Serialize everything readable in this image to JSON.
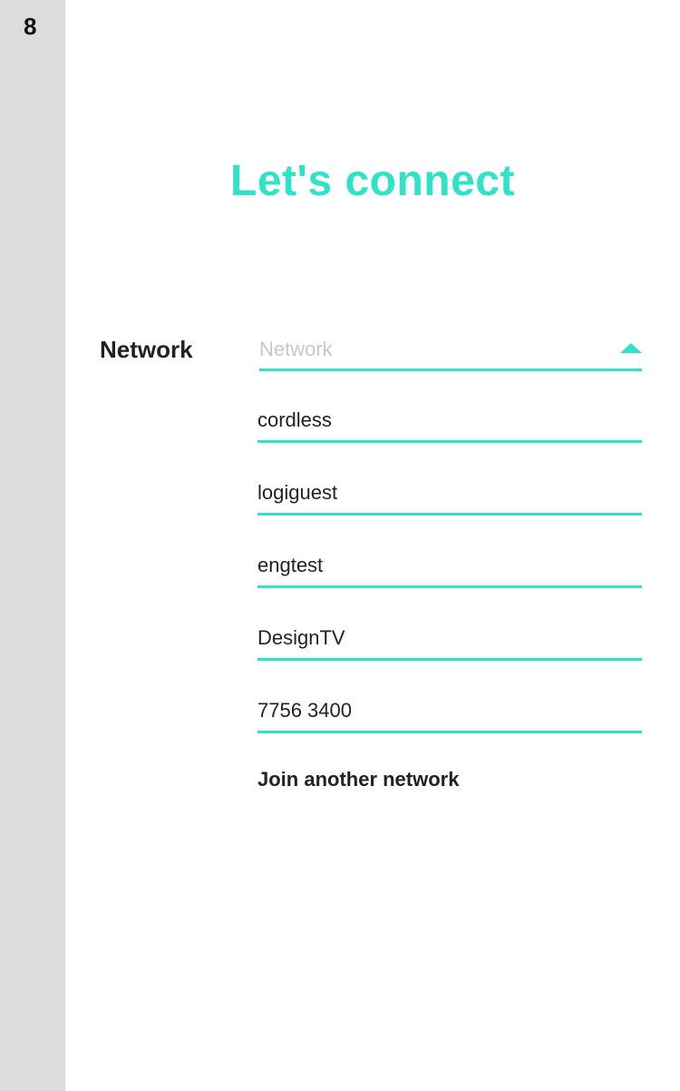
{
  "step": {
    "number": "8"
  },
  "title": "Let's connect",
  "network": {
    "label": "Network",
    "placeholder": "Network",
    "options": [
      {
        "label": "cordless"
      },
      {
        "label": "logiguest"
      },
      {
        "label": "engtest"
      },
      {
        "label": "DesignTV"
      },
      {
        "label": "7756 3400"
      }
    ],
    "join_label": "Join another network",
    "caret_icon": "caret-up-icon"
  },
  "colors": {
    "accent": "#2fe3c8",
    "rail": "#dcdcdc",
    "text": "#222222",
    "placeholder": "#c8c8c8"
  }
}
